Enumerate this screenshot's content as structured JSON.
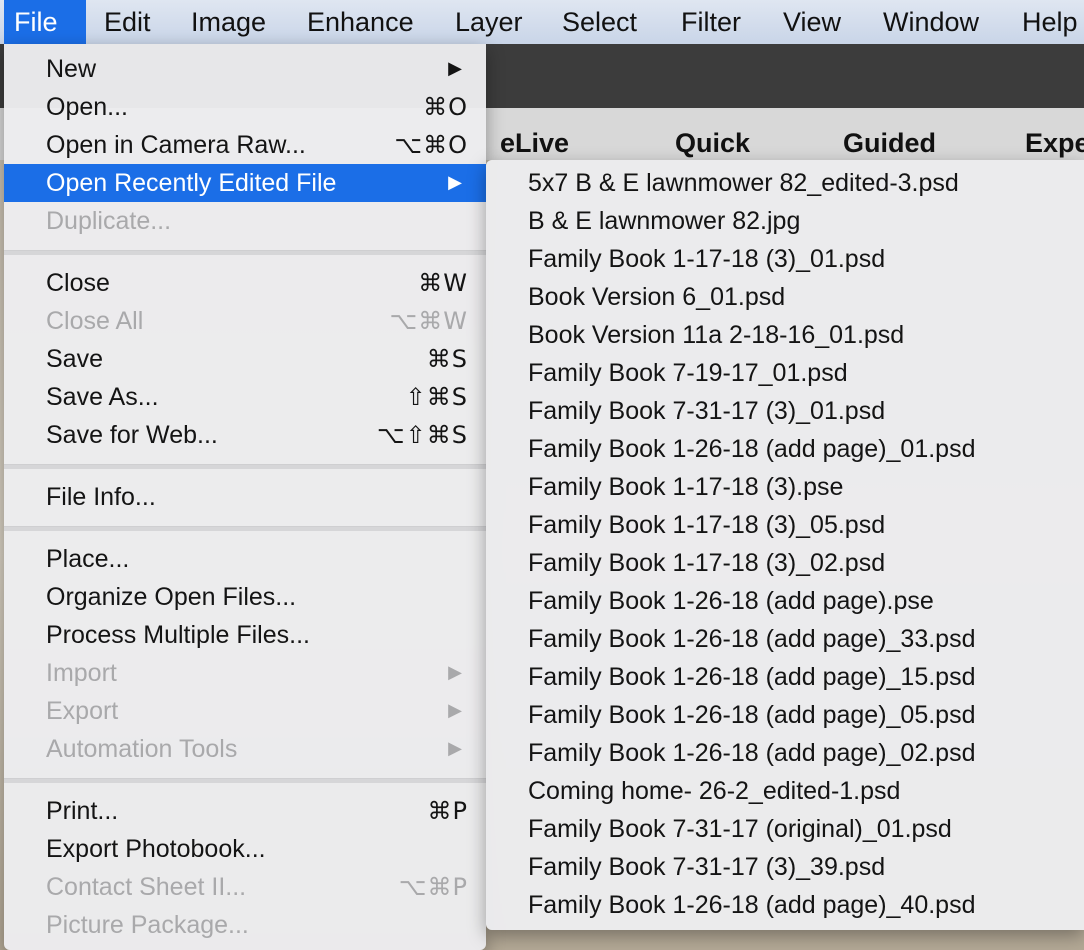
{
  "menubar": {
    "items": [
      "File",
      "Edit",
      "Image",
      "Enhance",
      "Layer",
      "Select",
      "Filter",
      "View",
      "Window",
      "Help"
    ]
  },
  "mode_bar": {
    "tabs": [
      "eLive",
      "Quick",
      "Guided",
      "Expe"
    ]
  },
  "file_menu": {
    "new": "New",
    "open": "Open...",
    "open_shortcut": "⌘O",
    "open_camera_raw": "Open in Camera Raw...",
    "open_camera_raw_shortcut": "⌥⌘O",
    "open_recent": "Open Recently Edited File",
    "duplicate": "Duplicate...",
    "close": "Close",
    "close_shortcut": "⌘W",
    "close_all": "Close All",
    "close_all_shortcut": "⌥⌘W",
    "save": "Save",
    "save_shortcut": "⌘S",
    "save_as": "Save As...",
    "save_as_shortcut": "⇧⌘S",
    "save_for_web": "Save for Web...",
    "save_for_web_shortcut": "⌥⇧⌘S",
    "file_info": "File Info...",
    "place": "Place...",
    "organize": "Organize Open Files...",
    "process_multiple": "Process Multiple Files...",
    "import": "Import",
    "export": "Export",
    "automation_tools": "Automation Tools",
    "print": "Print...",
    "print_shortcut": "⌘P",
    "export_photobook": "Export Photobook...",
    "contact_sheet": "Contact Sheet II...",
    "contact_sheet_shortcut": "⌥⌘P",
    "picture_package": "Picture Package..."
  },
  "recent_files": [
    "5x7 B & E lawnmower 82_edited-3.psd",
    "B & E lawnmower 82.jpg",
    "Family Book 1-17-18 (3)_01.psd",
    "Book Version 6_01.psd",
    "Book Version 11a 2-18-16_01.psd",
    "Family Book 7-19-17_01.psd",
    "Family Book 7-31-17 (3)_01.psd",
    "Family Book 1-26-18 (add page)_01.psd",
    "Family Book 1-17-18 (3).pse",
    "Family Book 1-17-18 (3)_05.psd",
    "Family Book 1-17-18 (3)_02.psd",
    "Family Book 1-26-18 (add page).pse",
    "Family Book 1-26-18 (add page)_33.psd",
    "Family Book 1-26-18 (add page)_15.psd",
    "Family Book 1-26-18 (add page)_05.psd",
    "Family Book 1-26-18 (add page)_02.psd",
    "Coming home- 26-2_edited-1.psd",
    "Family Book 7-31-17 (original)_01.psd",
    "Family Book 7-31-17 (3)_39.psd",
    "Family Book 1-26-18 (add page)_40.psd"
  ],
  "icons": {
    "submenu_arrow": "triangle-right-icon"
  }
}
